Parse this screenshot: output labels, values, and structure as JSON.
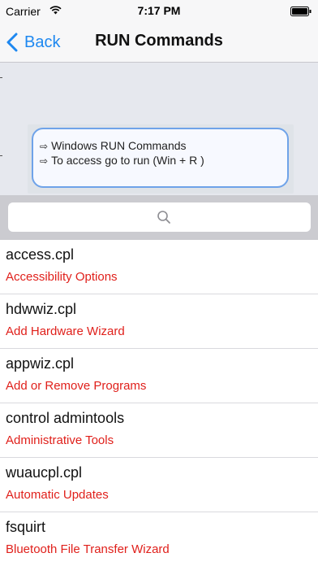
{
  "status": {
    "carrier": "Carrier",
    "time": "7:17 PM",
    "icons": [
      "wifi-icon",
      "battery-icon"
    ]
  },
  "nav": {
    "back_label": "Back",
    "title": "RUN Commands",
    "accent": "#1e88f0"
  },
  "banner": {
    "lines": [
      "Windows RUN Commands",
      "To access go to run (Win + R )"
    ],
    "bullet": "⇨"
  },
  "search": {
    "placeholder": ""
  },
  "list": {
    "desc_color": "#e0201b",
    "items": [
      {
        "command": "access.cpl",
        "description": "Accessibility Options"
      },
      {
        "command": "hdwwiz.cpl",
        "description": "Add Hardware Wizard"
      },
      {
        "command": "appwiz.cpl",
        "description": "Add or Remove Programs"
      },
      {
        "command": "control admintools",
        "description": "Administrative Tools"
      },
      {
        "command": "wuaucpl.cpl",
        "description": "Automatic Updates"
      },
      {
        "command": "fsquirt",
        "description": "Bluetooth File Transfer Wizard"
      }
    ]
  }
}
